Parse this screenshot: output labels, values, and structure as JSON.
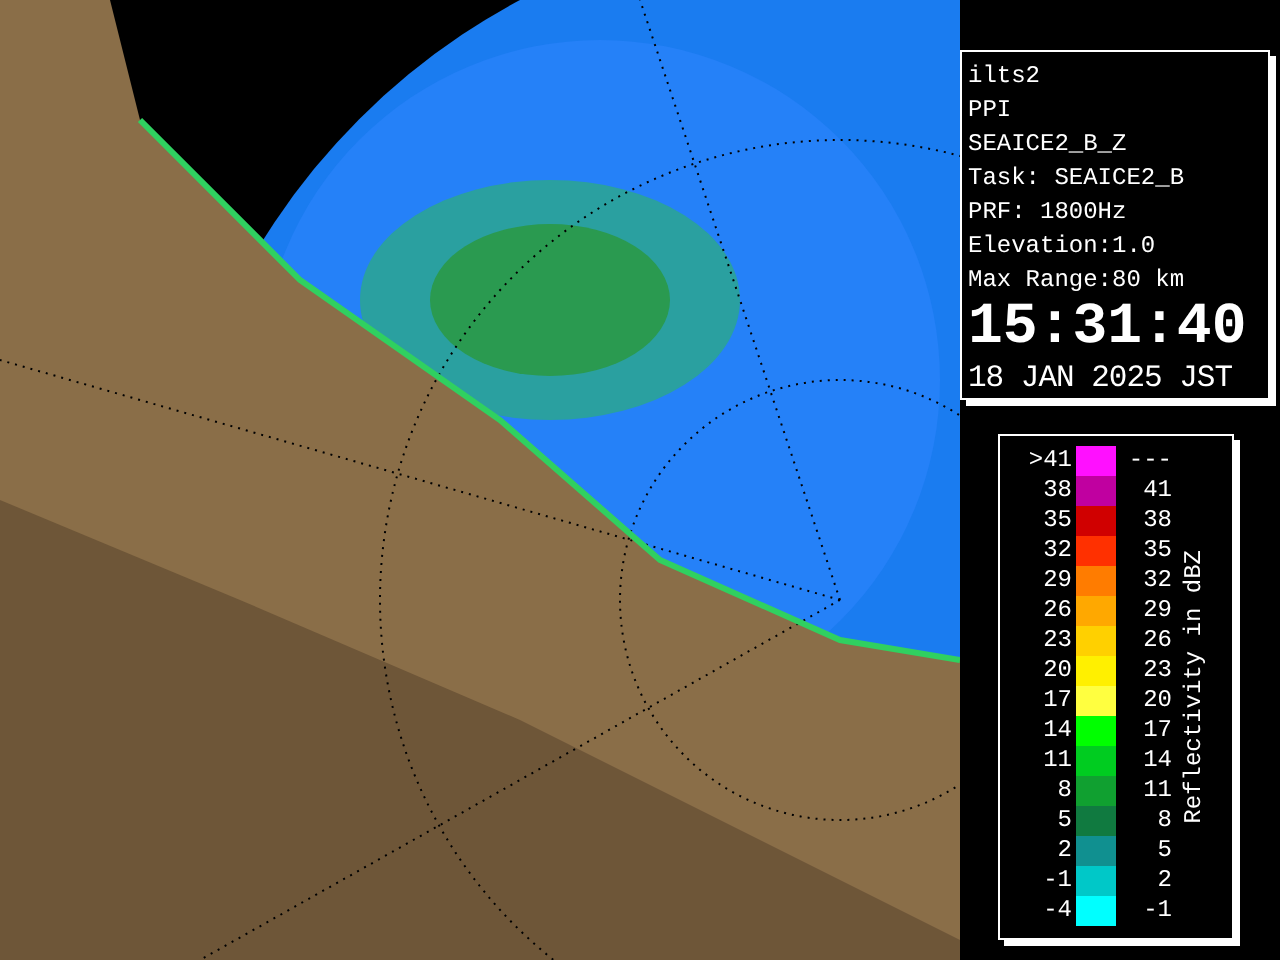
{
  "info": {
    "lines": [
      "ilts2",
      "PPI",
      "SEAICE2_B_Z",
      "Task: SEAICE2_B",
      "PRF: 1800Hz",
      "Elevation:1.0",
      "Max Range:80 km"
    ],
    "time": "15:31:40",
    "date": "18 JAN 2025 JST"
  },
  "legend": {
    "title": "Reflectivity in dBZ",
    "rows": [
      {
        "low": ">41",
        "high": "---",
        "color": "#ff10ff"
      },
      {
        "low": "38",
        "high": "41",
        "color": "#c000a0"
      },
      {
        "low": "35",
        "high": "38",
        "color": "#d00000"
      },
      {
        "low": "32",
        "high": "35",
        "color": "#ff3000"
      },
      {
        "low": "29",
        "high": "32",
        "color": "#ff7c00"
      },
      {
        "low": "26",
        "high": "29",
        "color": "#ffa800"
      },
      {
        "low": "23",
        "high": "26",
        "color": "#ffd000"
      },
      {
        "low": "20",
        "high": "23",
        "color": "#fff000"
      },
      {
        "low": "17",
        "high": "20",
        "color": "#ffff40"
      },
      {
        "low": "14",
        "high": "17",
        "color": "#00ff00"
      },
      {
        "low": "11",
        "high": "14",
        "color": "#00cc20"
      },
      {
        "low": "8",
        "high": "11",
        "color": "#10a030"
      },
      {
        "low": "5",
        "high": "8",
        "color": "#107a40"
      },
      {
        "low": "2",
        "high": "5",
        "color": "#109090"
      },
      {
        "low": "-1",
        "high": "2",
        "color": "#00c8c8"
      },
      {
        "low": "-4",
        "high": "-1",
        "color": "#00ffff"
      }
    ]
  }
}
